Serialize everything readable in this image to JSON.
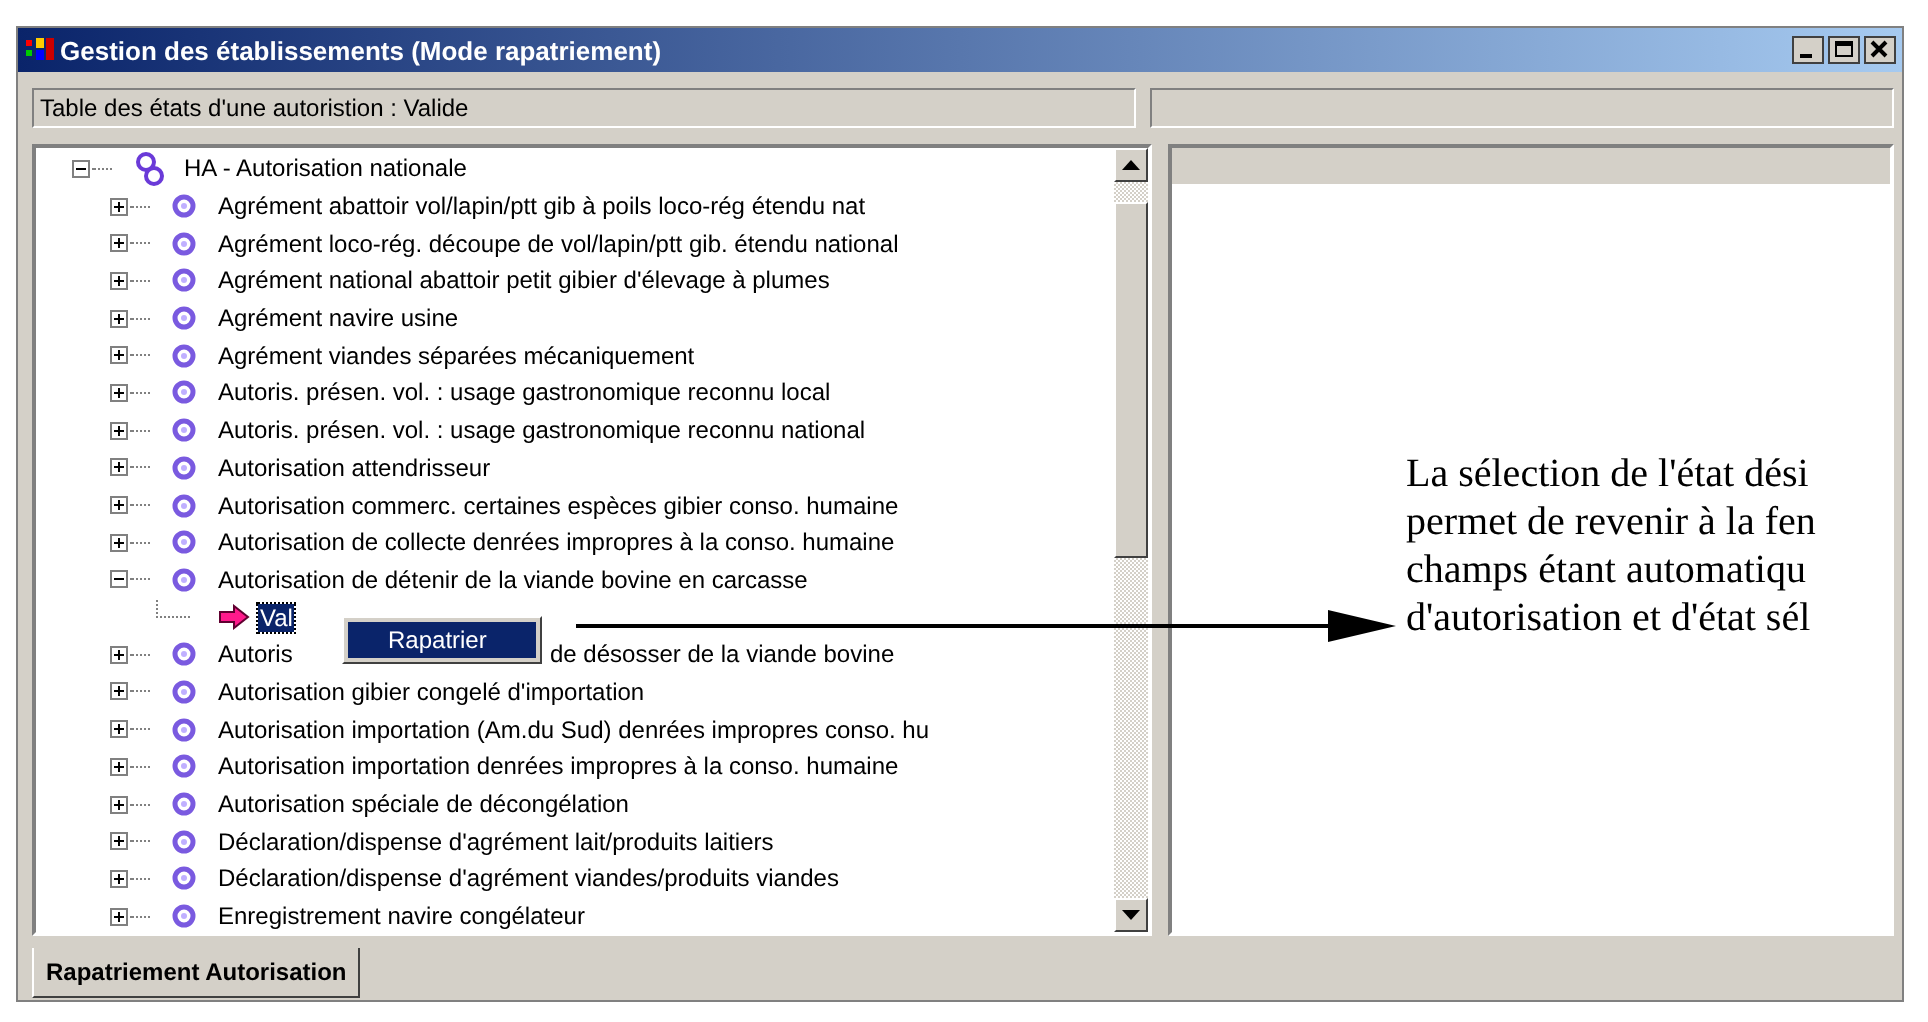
{
  "window": {
    "title": "Gestion des établissements (Mode rapatriement)"
  },
  "status_field": "Table des états d'une autoristion : Valide",
  "tree": [
    {
      "label": "HA - Autorisation nationale",
      "kind": "group",
      "expanded": true,
      "children": [
        {
          "label": "Agrément abattoir vol/lapin/ptt gib à poils loco-rég étendu nat",
          "kind": "item",
          "expanded": false
        },
        {
          "label": "Agrément loco-rég. découpe de vol/lapin/ptt gib. étendu national",
          "kind": "item",
          "expanded": false
        },
        {
          "label": "Agrément national abattoir petit gibier d'élevage à plumes",
          "kind": "item",
          "expanded": false
        },
        {
          "label": "Agrément navire usine",
          "kind": "item",
          "expanded": false
        },
        {
          "label": "Agrément viandes séparées mécaniquement",
          "kind": "item",
          "expanded": false
        },
        {
          "label": "Autoris. présen. vol. : usage gastronomique reconnu local",
          "kind": "item",
          "expanded": false
        },
        {
          "label": "Autoris. présen. vol. : usage gastronomique reconnu national",
          "kind": "item",
          "expanded": false
        },
        {
          "label": "Autorisation attendrisseur",
          "kind": "item",
          "expanded": false
        },
        {
          "label": "Autorisation commerc. certaines espèces gibier conso. humaine",
          "kind": "item",
          "expanded": false
        },
        {
          "label": "Autorisation de collecte denrées impropres à la conso. humaine",
          "kind": "item",
          "expanded": false
        },
        {
          "label": "Autorisation de détenir de la viande bovine en carcasse",
          "kind": "item",
          "expanded": true,
          "children": [
            {
              "label": "Val",
              "kind": "state",
              "selected": true,
              "context_menu": [
                "Rapatrier"
              ]
            }
          ]
        },
        {
          "label": "Autoris",
          "label_tail": "de désosser de la viande bovine",
          "kind": "item",
          "expanded": false
        },
        {
          "label": "Autorisation gibier congelé d'importation",
          "kind": "item",
          "expanded": false
        },
        {
          "label": "Autorisation importation (Am.du Sud) denrées impropres conso. hu",
          "kind": "item",
          "expanded": false
        },
        {
          "label": "Autorisation importation denrées impropres à la conso. humaine",
          "kind": "item",
          "expanded": false
        },
        {
          "label": "Autorisation spéciale de décongélation",
          "kind": "item",
          "expanded": false
        },
        {
          "label": "Déclaration/dispense d'agrément lait/produits laitiers",
          "kind": "item",
          "expanded": false
        },
        {
          "label": "Déclaration/dispense d'agrément viandes/produits viandes",
          "kind": "item",
          "expanded": false
        },
        {
          "label": "Enregistrement navire congélateur",
          "kind": "item",
          "expanded": false
        }
      ]
    }
  ],
  "tabs": [
    {
      "label": "Rapatriement Autorisation",
      "selected": true
    }
  ],
  "annotation": {
    "lines": [
      "La sélection de l'état dési",
      "permet de revenir à la fen",
      "champs étant automatiqu",
      "d'autorisation et d'état sél"
    ]
  }
}
